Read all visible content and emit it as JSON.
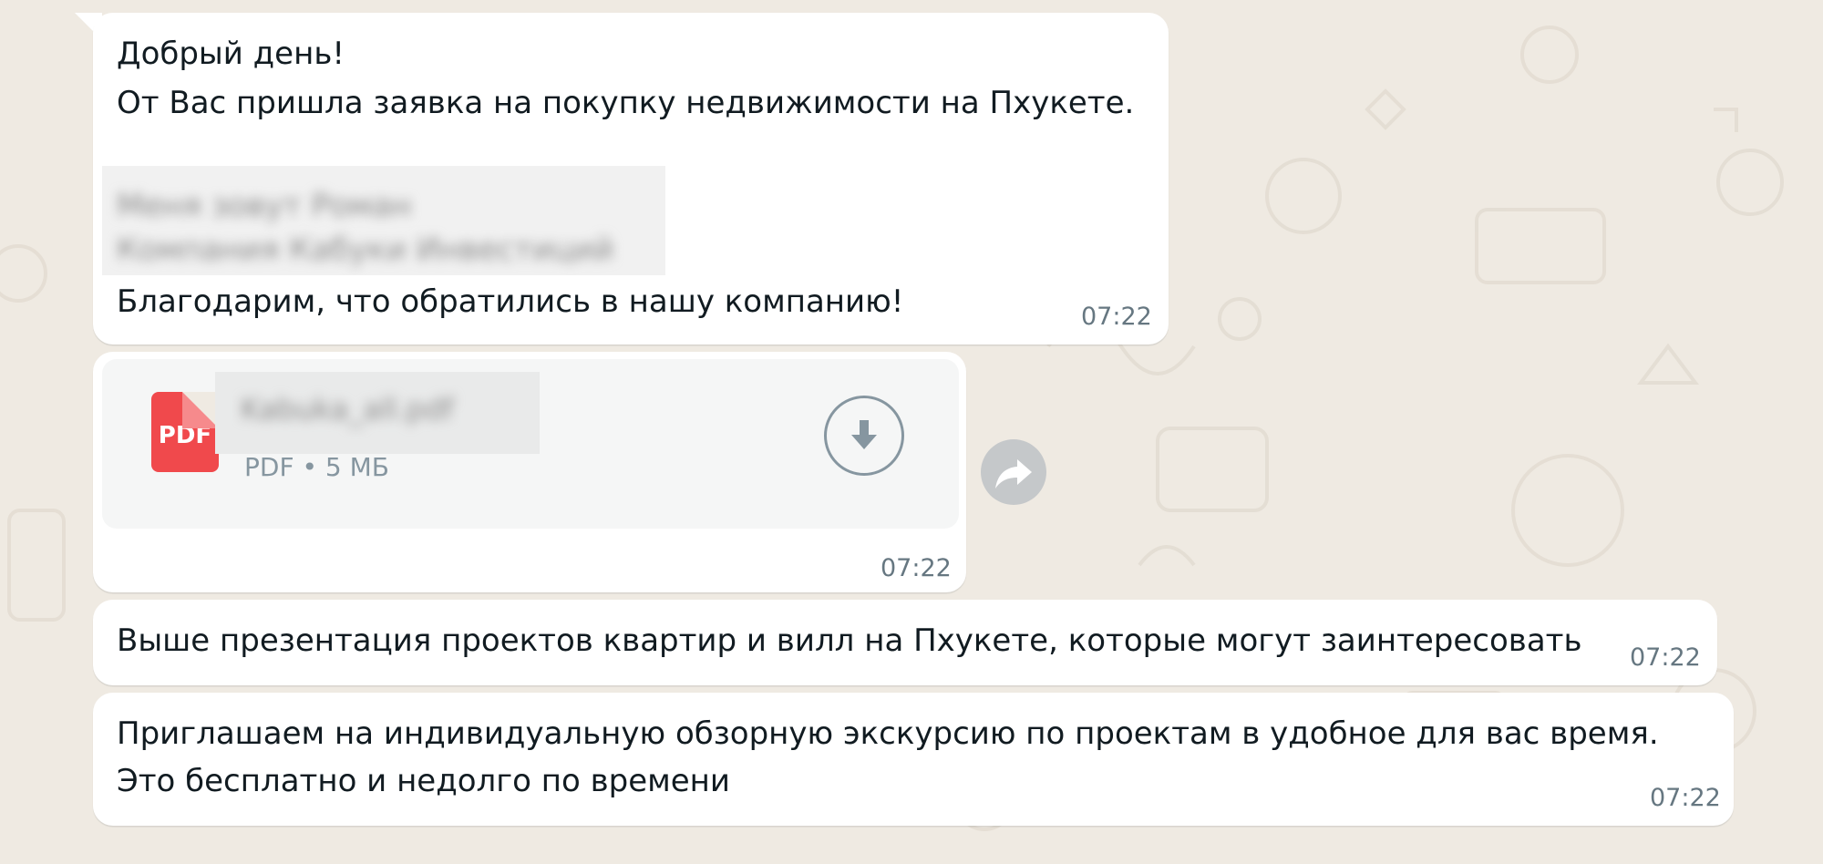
{
  "colors": {
    "chat_background": "#efeae2",
    "bubble": "#ffffff",
    "pdf_badge": "#f0494c",
    "time_text": "#667781"
  },
  "messages": [
    {
      "lines": [
        "Добрый день!",
        "От Вас пришла заявка на покупку недвижимости на Пхукете."
      ],
      "redacted_lines": [
        "Меня зовут Роман",
        "Компания Кабуки Инвестиций"
      ],
      "closing": "Благодарим, что обратились в нашу компанию!",
      "time": "07:22"
    },
    {
      "attachment": {
        "icon_label": "PDF",
        "file_name": "Kabuka_all.pdf",
        "meta": "PDF • 5 МБ",
        "download_icon": "download-icon",
        "forward_icon": "forward-icon"
      },
      "time": "07:22"
    },
    {
      "text": "Выше презентация проектов квартир и вилл на Пхукете, которые могут заинтересовать",
      "time": "07:22"
    },
    {
      "lines": [
        "Приглашаем на индивидуальную обзорную экскурсию по проектам в удобное для вас время.",
        "Это бесплатно и недолго по времени"
      ],
      "time": "07:22"
    }
  ]
}
